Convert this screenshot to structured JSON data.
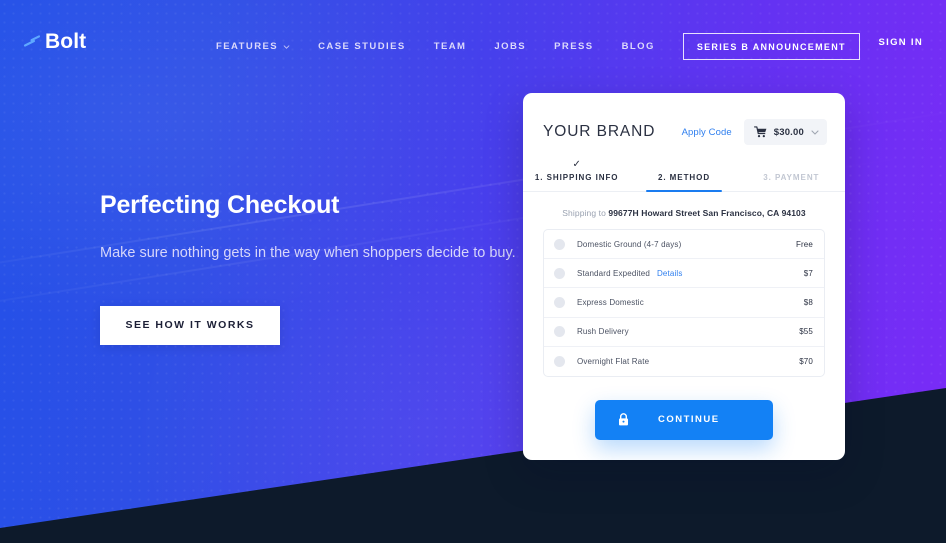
{
  "header": {
    "logo": {
      "text": "Bolt",
      "icon": "lightning-bolt-icon"
    },
    "nav": [
      {
        "label": "FEATURES",
        "has_caret": true
      },
      {
        "label": "CASE STUDIES",
        "has_caret": false
      },
      {
        "label": "TEAM",
        "has_caret": false
      },
      {
        "label": "JOBS",
        "has_caret": false
      },
      {
        "label": "PRESS",
        "has_caret": false
      },
      {
        "label": "BLOG",
        "has_caret": false
      }
    ],
    "cta_label": "SERIES B ANNOUNCEMENT",
    "signin_label": "SIGN IN"
  },
  "hero": {
    "title": "Perfecting Checkout",
    "subtitle": "Make sure nothing gets in the way when shoppers decide to buy.",
    "button_label": "SEE HOW IT WORKS"
  },
  "checkout": {
    "brand": "YOUR BRAND",
    "apply_code_label": "Apply Code",
    "cart": {
      "icon": "shopping-cart-icon",
      "amount": "$30.00",
      "caret": "chevron-down-icon"
    },
    "tabs": [
      {
        "label": "1. SHIPPING INFO",
        "state": "completed",
        "check": "✓"
      },
      {
        "label": "2. METHOD",
        "state": "active",
        "check": ""
      },
      {
        "label": "3. PAYMENT",
        "state": "disabled",
        "check": ""
      }
    ],
    "shipping_to_prefix": "Shipping to ",
    "shipping_to_address": "99677H Howard Street San Francisco, CA 94103",
    "options": [
      {
        "label": "Domestic Ground (4-7 days)",
        "details": "",
        "price": "Free",
        "selected": false
      },
      {
        "label": "Standard Expedited",
        "details": "Details",
        "price": "$7",
        "selected": false
      },
      {
        "label": "Express Domestic",
        "details": "",
        "price": "$8",
        "selected": false
      },
      {
        "label": "Rush Delivery",
        "details": "",
        "price": "$55",
        "selected": false
      },
      {
        "label": "Overnight Flat Rate",
        "details": "",
        "price": "$70",
        "selected": false
      }
    ],
    "continue_label": "CONTINUE",
    "continue_icon": "lock-icon"
  },
  "colors": {
    "gradient_start": "#2350e8",
    "gradient_end": "#7b2bf7",
    "dark_section": "#0d1a2b",
    "accent_blue": "#1381f5",
    "link_blue": "#2f7fef"
  }
}
